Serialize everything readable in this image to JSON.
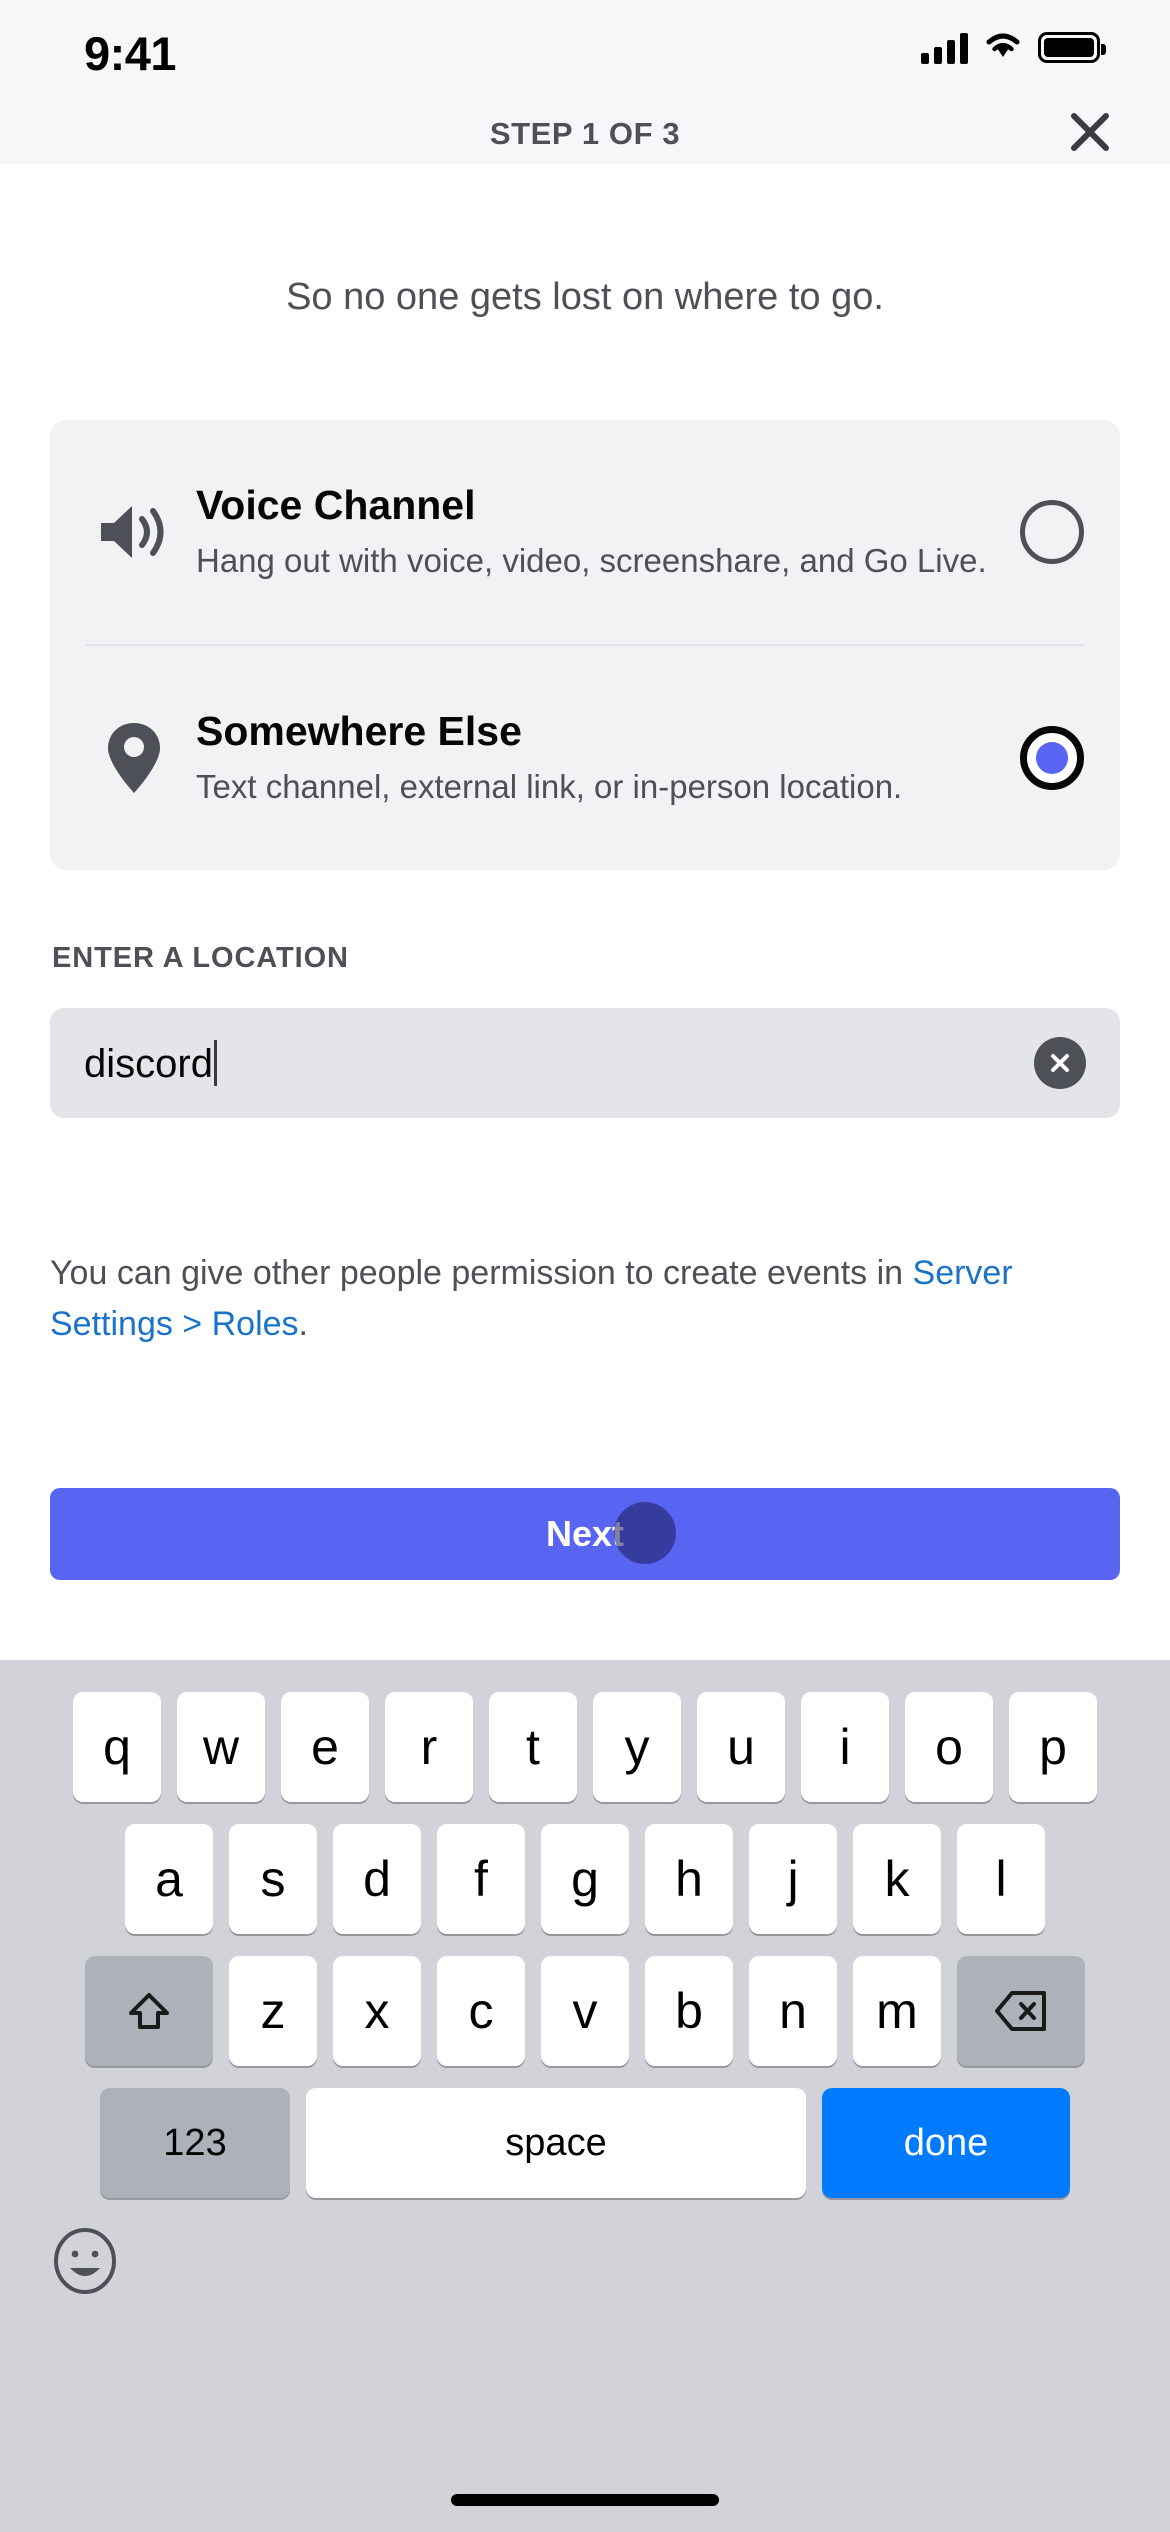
{
  "status_bar": {
    "time": "9:41",
    "cellular_icon": "cellular-signal-icon",
    "wifi_icon": "wifi-icon",
    "battery_icon": "battery-icon"
  },
  "header": {
    "title": "STEP 1 OF 3",
    "close_icon": "close-icon"
  },
  "main": {
    "subtitle": "So no one gets lost on where to go.",
    "options": [
      {
        "icon": "speaker-volume-icon",
        "title": "Voice Channel",
        "description": "Hang out with voice, video, screenshare, and Go Live.",
        "selected": false
      },
      {
        "icon": "location-pin-icon",
        "title": "Somewhere Else",
        "description": "Text channel, external link, or in-person location.",
        "selected": true
      }
    ],
    "location_field": {
      "label": "ENTER A LOCATION",
      "value": "discord",
      "placeholder": "Enter a location",
      "clear_icon": "clear-circle-icon"
    },
    "helper": {
      "text_before": "You can give other people permission to create events in ",
      "link_text": "Server Settings > Roles",
      "text_after": ".",
      "link_color": "#1A73C7"
    },
    "next_button": {
      "label": "Next",
      "color": "#5865F2"
    }
  },
  "keyboard": {
    "row1": [
      "q",
      "w",
      "e",
      "r",
      "t",
      "y",
      "u",
      "i",
      "o",
      "p"
    ],
    "row2": [
      "a",
      "s",
      "d",
      "f",
      "g",
      "h",
      "j",
      "k",
      "l"
    ],
    "row3": [
      "z",
      "x",
      "c",
      "v",
      "b",
      "n",
      "m"
    ],
    "shift_icon": "shift-arrow-icon",
    "backspace_icon": "backspace-delete-icon",
    "numbers_key": "123",
    "space_key": "space",
    "done_key": "done",
    "done_color": "#007AFF",
    "emoji_icon": "emoji-smiley-icon",
    "home_indicator": "home-indicator-bar"
  }
}
